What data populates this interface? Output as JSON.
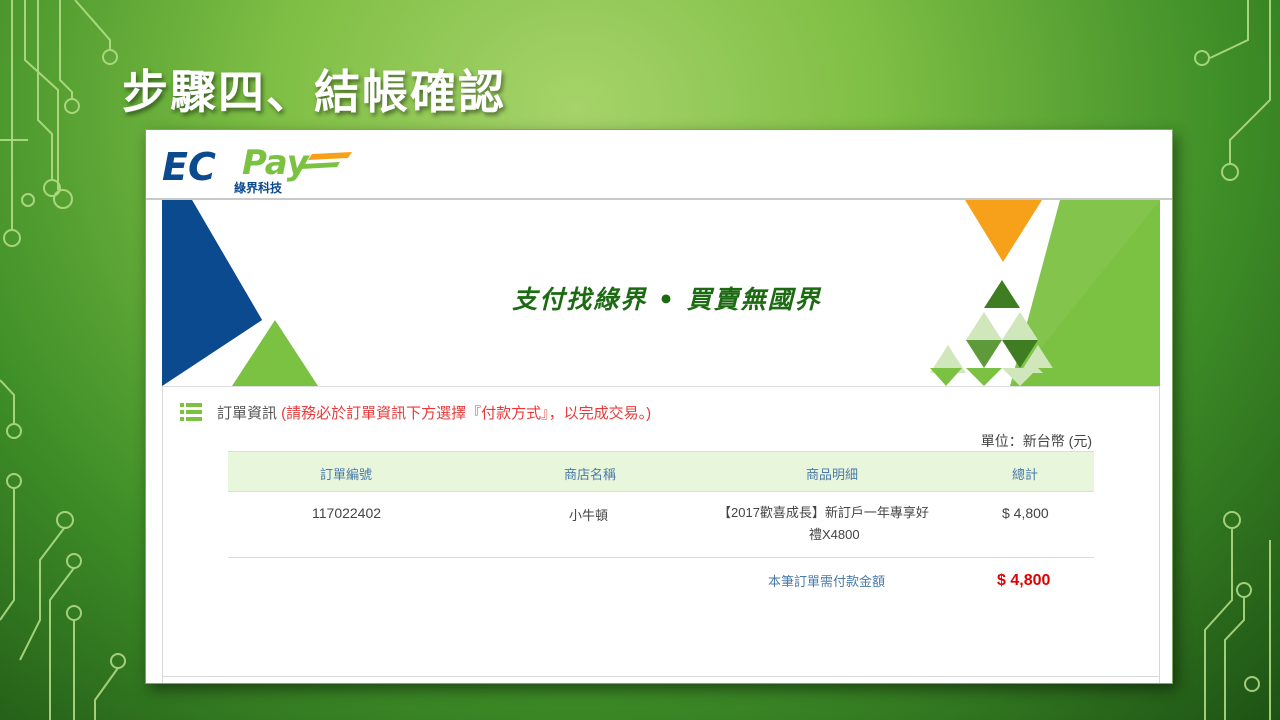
{
  "slide": {
    "title": "步驟四、結帳確認"
  },
  "logo": {
    "brand_main": "EC",
    "brand_pay": "Pay",
    "subtitle": "綠界科技"
  },
  "banner": {
    "slogan": "支付找綠界 • 買賣無國界"
  },
  "order": {
    "header_label": "訂單資訊",
    "header_note": " (請務必於訂單資訊下方選擇『付款方式』，以完成交易。)",
    "unit": "單位：新台幣 (元)",
    "columns": [
      "訂單編號",
      "商店名稱",
      "商品明細",
      "總計"
    ],
    "rows": [
      {
        "order_no": "117022402",
        "store": "小牛頓",
        "item_line1": "【2017歡喜成長】新訂戶一年專享好",
        "item_line2": "禮X4800",
        "total": "$ 4,800"
      }
    ],
    "total_label": "本筆訂單需付款金額",
    "total_value": "$ 4,800"
  },
  "colors": {
    "brand_blue": "#0b4a8f",
    "brand_green": "#7cc242",
    "accent_orange": "#f7a11a",
    "dark_green": "#1c6a12",
    "alert_red": "#e00000"
  }
}
